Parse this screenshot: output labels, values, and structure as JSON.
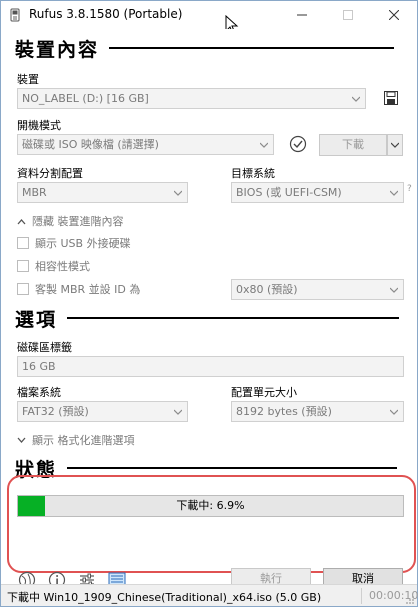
{
  "window": {
    "title": "Rufus 3.8.1580 (Portable)"
  },
  "device_section": {
    "title": "裝置內容",
    "device_label": "裝置",
    "device_value": "NO_LABEL (D:) [16 GB]",
    "boot_label": "開機模式",
    "boot_value": "磁碟或 ISO 映像檔 (請選擇)",
    "download_label": "下載",
    "partition_label": "資料分割配置",
    "partition_value": "MBR",
    "target_label": "目標系統",
    "target_value": "BIOS (或 UEFI-CSM)",
    "help_mark": "?",
    "advanced_toggle": "隱藏 裝置進階內容",
    "usb_hdd_label": "顯示 USB 外接硬碟",
    "compat_label": "相容性模式",
    "mbr_id_label": "客製 MBR 並設 ID 為",
    "mbr_id_value": "0x80 (預設)"
  },
  "options_section": {
    "title": "選項",
    "volume_label": "磁碟區標籤",
    "volume_value": "16 GB",
    "filesystem_label": "檔案系統",
    "filesystem_value": "FAT32 (預設)",
    "cluster_label": "配置單元大小",
    "cluster_value": "8192 bytes (預設)",
    "format_toggle": "顯示 格式化進階選項"
  },
  "status_section": {
    "title": "狀態",
    "progress_text": "下載中: 6.9%",
    "progress_fraction": 0.069
  },
  "actions": {
    "start_label": "執行",
    "cancel_label": "取消"
  },
  "statusbar": {
    "text": "下載中 Win10_1909_Chinese(Traditional)_x64.iso (5.0 GB)",
    "time": "00:00:10"
  },
  "colors": {
    "progress_fill": "#06b025",
    "highlight": "#e05252"
  }
}
